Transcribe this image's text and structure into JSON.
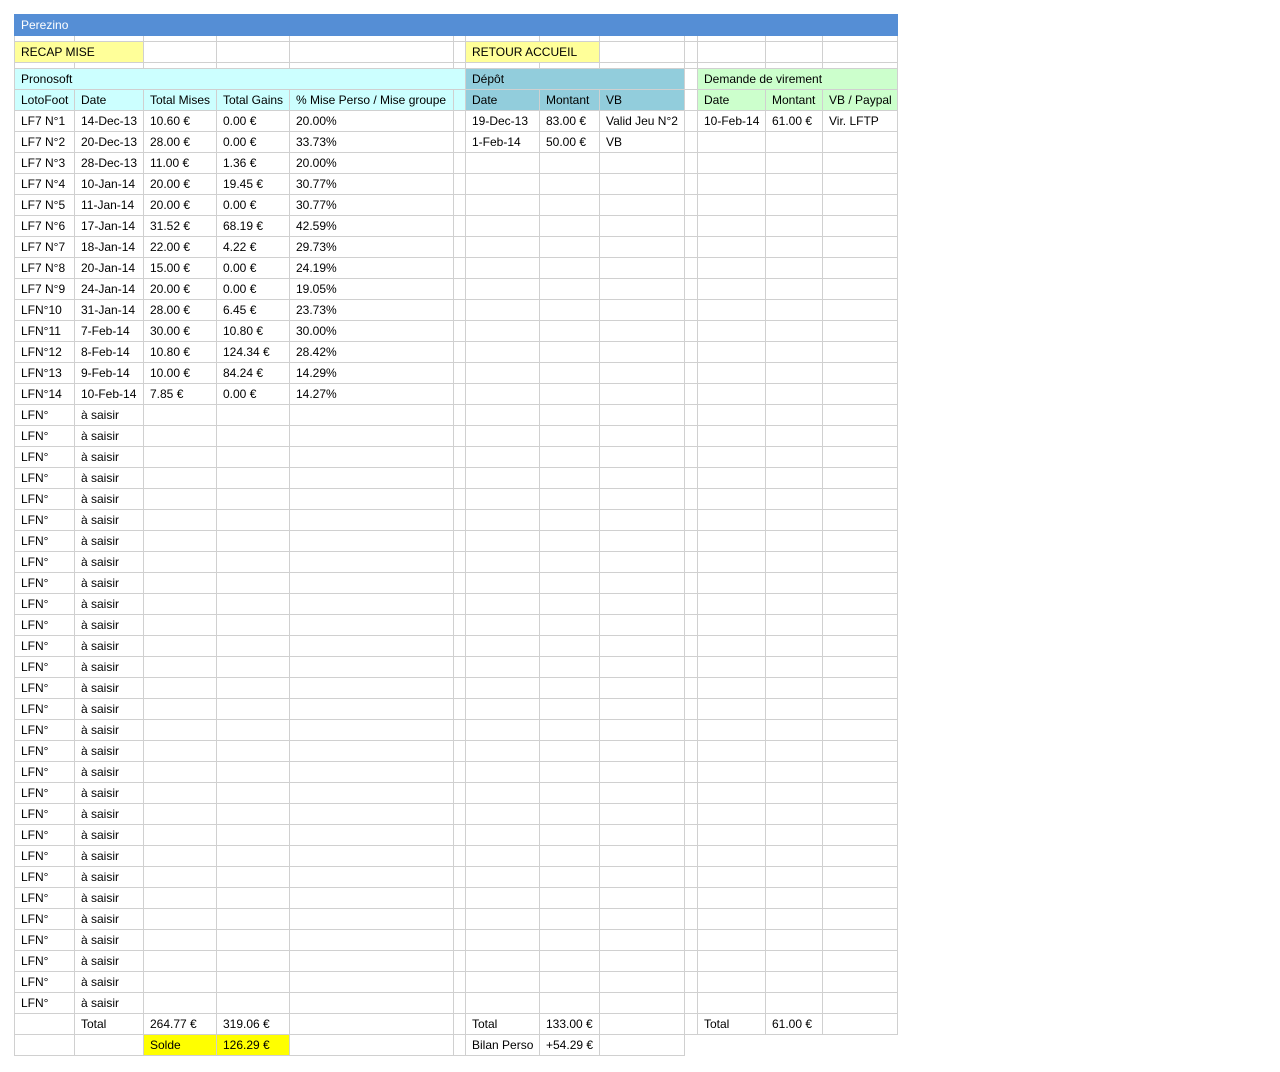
{
  "sheet_title": "Perezino",
  "buttons": {
    "recap": "RECAP MISE",
    "accueil": "RETOUR ACCUEIL"
  },
  "pronosoft": {
    "title": "Pronosoft",
    "headers": [
      "LotoFoot",
      "Date",
      "Total Mises",
      "Total Gains",
      "% Mise Perso / Mise groupe"
    ],
    "rows": [
      [
        "LF7 N°1",
        "14-Dec-13",
        "10.60 €",
        "0.00 €",
        "20.00%"
      ],
      [
        "LF7 N°2",
        "20-Dec-13",
        "28.00 €",
        "0.00 €",
        "33.73%"
      ],
      [
        "LF7 N°3",
        "28-Dec-13",
        "11.00 €",
        "1.36 €",
        "20.00%"
      ],
      [
        "LF7 N°4",
        "10-Jan-14",
        "20.00 €",
        "19.45 €",
        "30.77%"
      ],
      [
        "LF7 N°5",
        "11-Jan-14",
        "20.00 €",
        "0.00 €",
        "30.77%"
      ],
      [
        "LF7 N°6",
        "17-Jan-14",
        "31.52 €",
        "68.19 €",
        "42.59%"
      ],
      [
        "LF7 N°7",
        "18-Jan-14",
        "22.00 €",
        "4.22 €",
        "29.73%"
      ],
      [
        "LF7 N°8",
        "20-Jan-14",
        "15.00 €",
        "0.00 €",
        "24.19%"
      ],
      [
        "LF7 N°9",
        "24-Jan-14",
        "20.00 €",
        "0.00 €",
        "19.05%"
      ],
      [
        "LFN°10",
        "31-Jan-14",
        "28.00 €",
        "6.45 €",
        "23.73%"
      ],
      [
        "LFN°11",
        "7-Feb-14",
        "30.00 €",
        "10.80 €",
        "30.00%"
      ],
      [
        "LFN°12",
        "8-Feb-14",
        "10.80 €",
        "124.34 €",
        "28.42%"
      ],
      [
        "LFN°13",
        "9-Feb-14",
        "10.00 €",
        "84.24 €",
        "14.29%"
      ],
      [
        "LFN°14",
        "10-Feb-14",
        "7.85 €",
        "0.00 €",
        "14.27%"
      ]
    ],
    "placeholder_label": "LFN°",
    "placeholder_date": "à saisir",
    "placeholder_count": 29,
    "total_label": "Total",
    "total_mises": "264.77 €",
    "total_gains": "319.06 €",
    "solde_label": "Solde",
    "solde_value": "126.29 €"
  },
  "depot": {
    "title": "Dépôt",
    "headers": [
      "Date",
      "Montant",
      "VB"
    ],
    "rows": [
      [
        "19-Dec-13",
        "83.00 €",
        "Valid Jeu N°2"
      ],
      [
        "1-Feb-14",
        "50.00 €",
        "VB"
      ]
    ],
    "total_label": "Total",
    "total_value": "133.00 €",
    "bilan_label": "Bilan Perso",
    "bilan_value": "+54.29 €"
  },
  "virement": {
    "title": "Demande de virement",
    "headers": [
      "Date",
      "Montant",
      "VB / Paypal"
    ],
    "rows": [
      [
        "10-Feb-14",
        "61.00 €",
        "Vir. LFTP"
      ]
    ],
    "total_label": "Total",
    "total_value": "61.00 €"
  }
}
